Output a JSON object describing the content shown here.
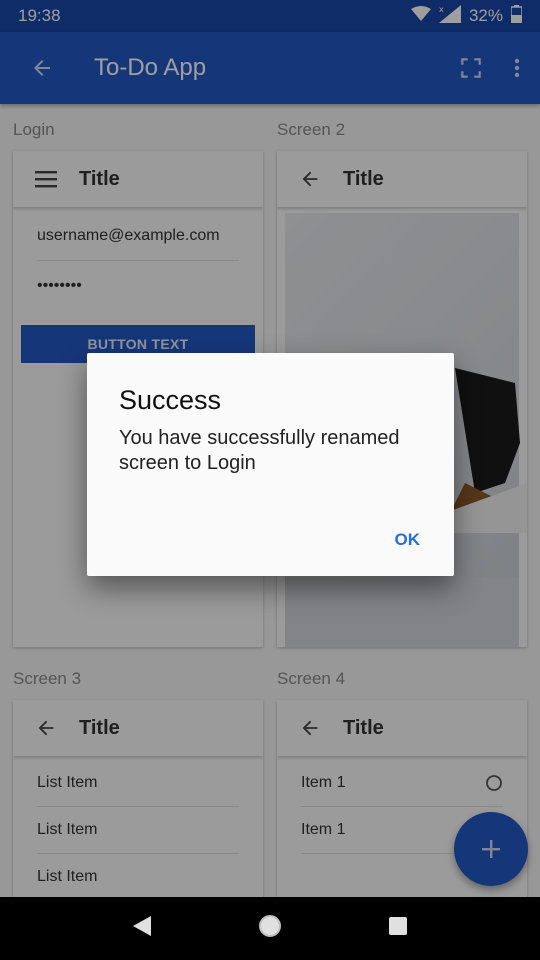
{
  "status_bar": {
    "time": "19:38",
    "battery": "32%"
  },
  "app_bar": {
    "title": "To-Do App"
  },
  "screens": [
    {
      "label": "Login",
      "title": "Title",
      "fields": [
        "username@example.com",
        "••••••••"
      ],
      "button": "BUTTON TEXT"
    },
    {
      "label": "Screen 2",
      "title": "Title"
    },
    {
      "label": "Screen 3",
      "title": "Title",
      "items": [
        "List Item",
        "List Item",
        "List Item"
      ]
    },
    {
      "label": "Screen 4",
      "title": "Title",
      "items": [
        "Item 1",
        "Item 1"
      ]
    }
  ],
  "dialog": {
    "title": "Success",
    "message": "You have successfully renamed screen to Login",
    "ok": "OK"
  },
  "colors": {
    "primary": "#2457c5",
    "status": "#1a47a8",
    "accent": "#2a6de0"
  }
}
